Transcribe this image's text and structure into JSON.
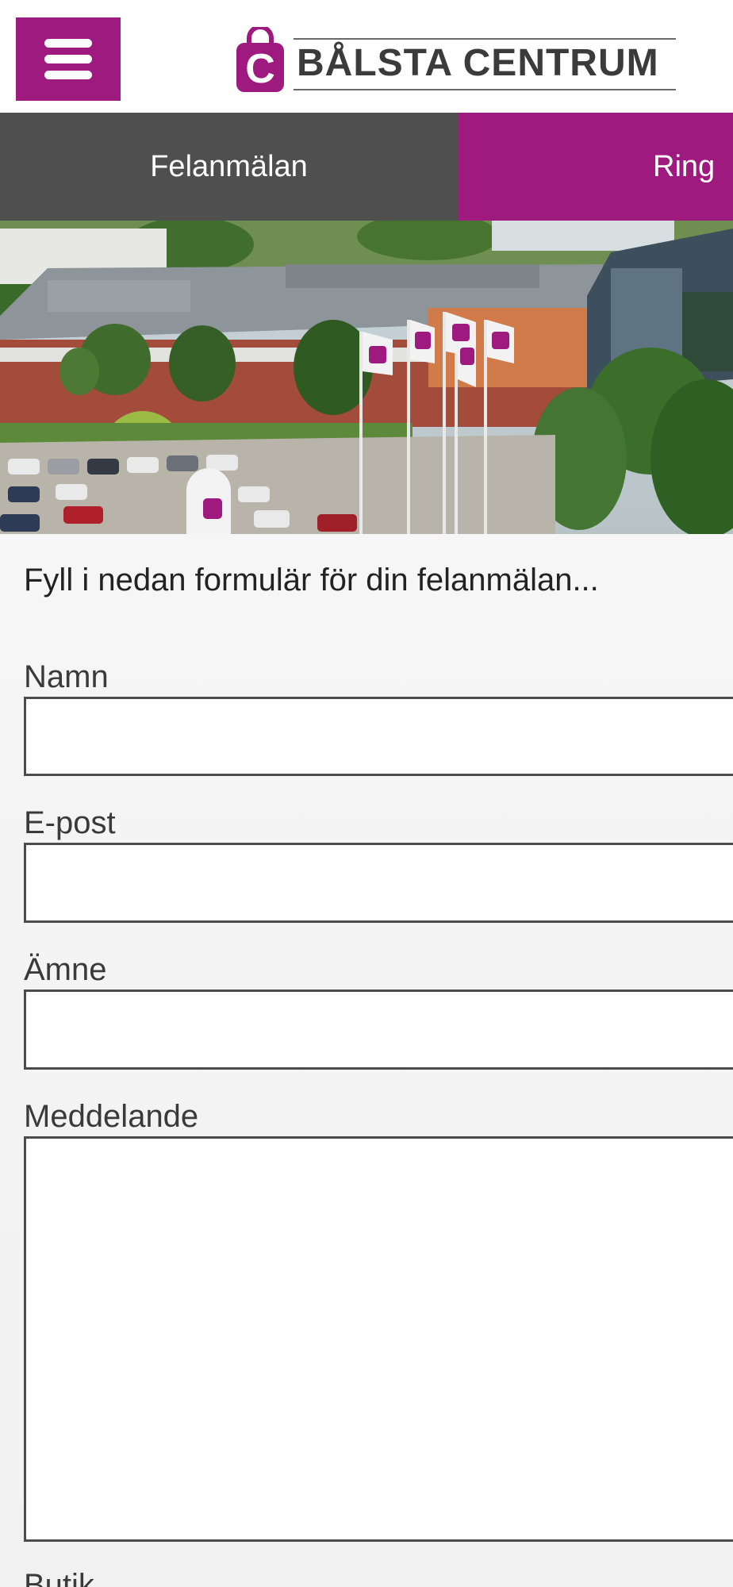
{
  "header": {
    "logo_text": "BÅLSTA CENTRUM",
    "logo_letter": "C",
    "brand_color": "#9e1a7f"
  },
  "tabs": [
    {
      "label": "Felanmälan",
      "color": "#4f4f4f"
    },
    {
      "label": "Ring",
      "color": "#9e1a7f"
    }
  ],
  "form": {
    "intro": "Fyll i nedan formulär för din felanmälan...",
    "fields": {
      "name": {
        "label": "Namn",
        "value": ""
      },
      "email": {
        "label": "E-post",
        "value": ""
      },
      "subject": {
        "label": "Ämne",
        "value": ""
      },
      "message": {
        "label": "Meddelande",
        "value": ""
      },
      "store": {
        "label": "Butik"
      }
    }
  }
}
